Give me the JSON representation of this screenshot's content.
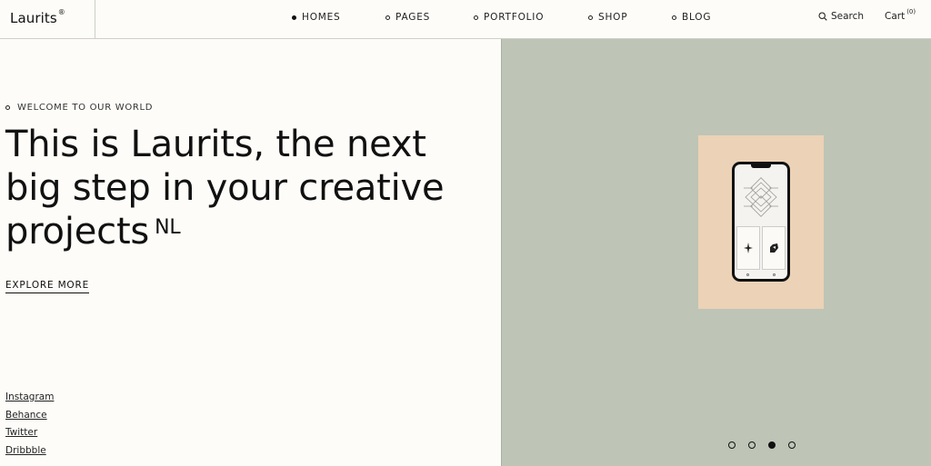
{
  "brand": {
    "name": "Laurits",
    "mark": "®"
  },
  "nav": {
    "items": [
      {
        "label": "HOMES",
        "active": true
      },
      {
        "label": "PAGES",
        "active": false
      },
      {
        "label": "PORTFOLIO",
        "active": false
      },
      {
        "label": "SHOP",
        "active": false
      },
      {
        "label": "BLOG",
        "active": false
      }
    ],
    "search_label": "Search",
    "cart_label": "Cart",
    "cart_count": "(0)"
  },
  "hero": {
    "eyebrow": "WELCOME TO OUR WORLD",
    "headline_line1": "This is Laurits, the next",
    "headline_line2": "big step in your creative",
    "headline_line3": "projects",
    "headline_sup": "NL",
    "cta": "EXPLORE MORE"
  },
  "social": [
    "Instagram",
    "Behance",
    "Twitter",
    "Dribbble"
  ],
  "slider": {
    "active_index": 2,
    "count": 4
  },
  "colors": {
    "background": "#fdfcf8",
    "panel": "#bec5b6",
    "card": "#ecd2b6",
    "text": "#111111"
  },
  "icons": {
    "search": "search-icon",
    "nav_bullet": "bullet-dot-icon"
  }
}
